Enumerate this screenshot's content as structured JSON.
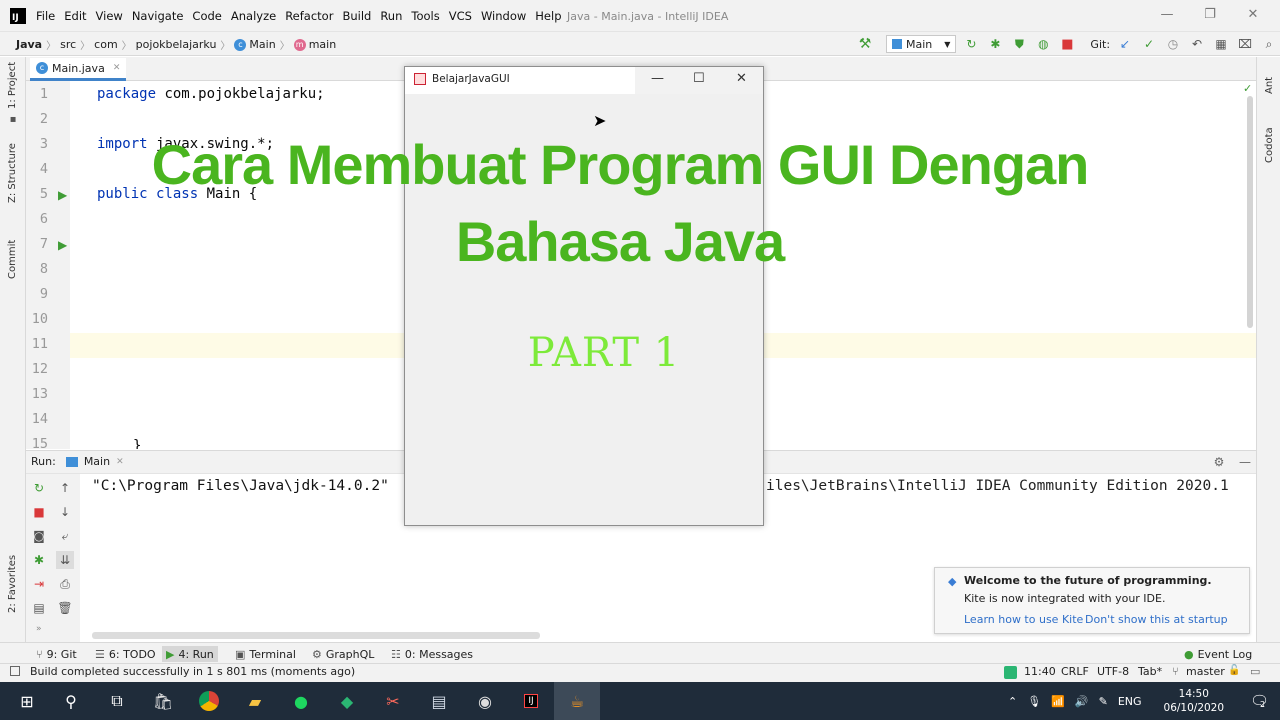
{
  "title_bar": {
    "menu": [
      "File",
      "Edit",
      "View",
      "Navigate",
      "Code",
      "Analyze",
      "Refactor",
      "Build",
      "Run",
      "Tools",
      "VCS",
      "Window",
      "Help"
    ],
    "window_title": "Java - Main.java - IntelliJ IDEA"
  },
  "nav_bar": {
    "breadcrumbs": [
      "Java",
      "src",
      "com",
      "pojokbelajarku",
      "Main",
      "main"
    ],
    "run_config": "Main",
    "git_label": "Git:"
  },
  "left_strip": {
    "project": "1: Project",
    "structure": "Z: Structure",
    "commit": "Commit",
    "favorites": "2: Favorites"
  },
  "right_strip": {
    "ant": "Ant",
    "codota": "Codota"
  },
  "editor": {
    "tab_label": "Main.java",
    "line_numbers": [
      "1",
      "2",
      "3",
      "4",
      "5",
      "6",
      "7",
      "8",
      "9",
      "10",
      "11",
      "12",
      "13",
      "14",
      "15"
    ],
    "lines": {
      "l1_kw": "package",
      "l1_rest": " com.pojokbelajarku;",
      "l3_kw": "import",
      "l3_rest": " javax.swing.*;",
      "l5_kw": "public class",
      "l5_rest": " Main {",
      "l15": "}"
    }
  },
  "run_panel": {
    "label": "Run:",
    "tab": "Main",
    "console_left": "\"C:\\Program Files\\Java\\jdk-14.0.2\"",
    "console_right": "iles\\JetBrains\\IntelliJ IDEA Community Edition 2020.1"
  },
  "gui_window": {
    "title": "BelajarJavaGUI"
  },
  "overlay": {
    "heading_line1": "Cara Membuat Program GUI Dengan",
    "heading_line2": "Bahasa Java",
    "part": "PART 1"
  },
  "notification": {
    "title": "Welcome to the future of programming.",
    "body": "Kite is now integrated with your IDE.",
    "link1": "Learn how to use Kite",
    "link2": "Don't show this at startup"
  },
  "bottom_tools": {
    "git": "9: Git",
    "todo": "6: TODO",
    "run": "4: Run",
    "terminal": "Terminal",
    "graphql": "GraphQL",
    "messages": "0: Messages",
    "event_log": "Event Log"
  },
  "status_bar": {
    "message": "Build completed successfully in 1 s 801 ms (moments ago)",
    "position": "11:40",
    "line_sep": "CRLF",
    "encoding": "UTF-8",
    "indent": "Tab*",
    "branch": "master"
  },
  "taskbar": {
    "lang": "ENG",
    "time": "14:50",
    "date": "06/10/2020",
    "notif_count": "2"
  }
}
